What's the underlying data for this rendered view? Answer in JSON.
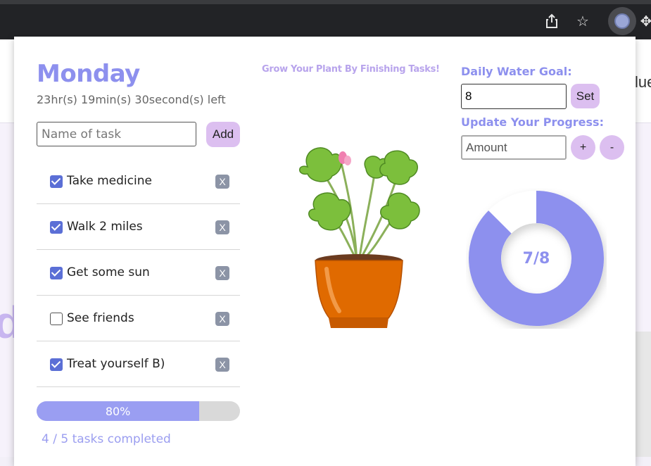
{
  "browser": {
    "icons": [
      "share-icon",
      "star-icon",
      "extension-icon",
      "puzzle-icon"
    ]
  },
  "header": {
    "day": "Monday",
    "time_left": "23hr(s) 19min(s) 30second(s) left"
  },
  "task_form": {
    "placeholder": "Name of task",
    "add_label": "Add"
  },
  "tasks": [
    {
      "label": "Take medicine",
      "done": true,
      "delete_label": "X"
    },
    {
      "label": "Walk 2 miles",
      "done": true,
      "delete_label": "X"
    },
    {
      "label": "Get some sun",
      "done": true,
      "delete_label": "X"
    },
    {
      "label": "See friends",
      "done": false,
      "delete_label": "X"
    },
    {
      "label": "Treat yourself B)",
      "done": true,
      "delete_label": "X"
    }
  ],
  "progress": {
    "percent": 80,
    "label": "80%",
    "summary": "4 / 5 tasks completed"
  },
  "plant": {
    "heading": "Grow Your Plant By Finishing Tasks!"
  },
  "water": {
    "goal_label": "Daily Water Goal:",
    "goal_value": "8",
    "set_label": "Set",
    "update_label": "Update Your Progress:",
    "amount_placeholder": "Amount",
    "plus_label": "+",
    "minus_label": "-",
    "current": 7,
    "goal": 8,
    "ratio_label": "7/8"
  },
  "colors": {
    "accent": "#8d90ee",
    "button": "#dcbff0",
    "progress_fill": "#9a9ef2",
    "donut_empty": "#ffffff"
  }
}
